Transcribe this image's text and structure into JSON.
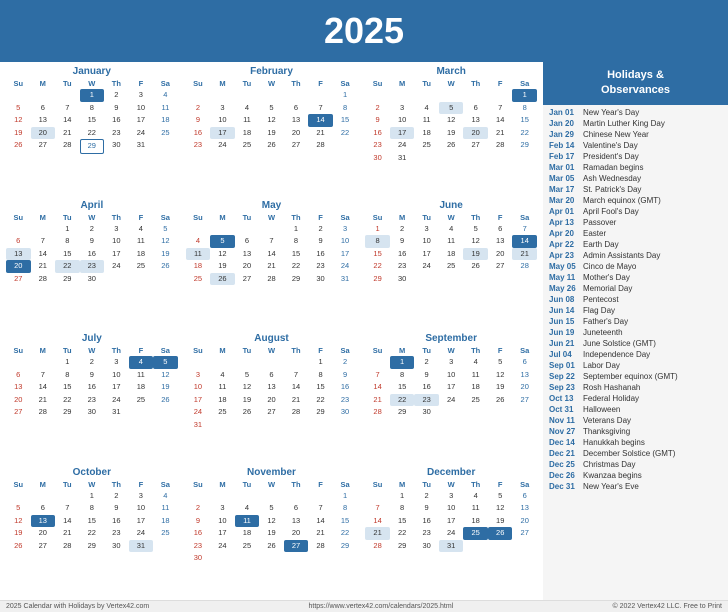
{
  "header": {
    "year": "2025"
  },
  "footer": {
    "left": "2025 Calendar with Holidays by Vertex42.com",
    "center": "https://www.vertex42.com/calendars/2025.html",
    "right": "© 2022 Vertex42 LLC. Free to Print"
  },
  "holidays_header": "Holidays &\nObservances",
  "holidays": [
    {
      "date": "Jan 01",
      "name": "New Year's Day"
    },
    {
      "date": "Jan 20",
      "name": "Martin Luther King Day"
    },
    {
      "date": "Jan 29",
      "name": "Chinese New Year"
    },
    {
      "date": "Feb 14",
      "name": "Valentine's Day"
    },
    {
      "date": "Feb 17",
      "name": "President's Day"
    },
    {
      "date": "Mar 01",
      "name": "Ramadan begins"
    },
    {
      "date": "Mar 05",
      "name": "Ash Wednesday"
    },
    {
      "date": "Mar 17",
      "name": "St. Patrick's Day"
    },
    {
      "date": "Mar 20",
      "name": "March equinox (GMT)"
    },
    {
      "date": "Apr 01",
      "name": "April Fool's Day"
    },
    {
      "date": "Apr 13",
      "name": "Passover"
    },
    {
      "date": "Apr 20",
      "name": "Easter"
    },
    {
      "date": "Apr 22",
      "name": "Earth Day"
    },
    {
      "date": "Apr 23",
      "name": "Admin Assistants Day"
    },
    {
      "date": "May 05",
      "name": "Cinco de Mayo"
    },
    {
      "date": "May 11",
      "name": "Mother's Day"
    },
    {
      "date": "May 26",
      "name": "Memorial Day"
    },
    {
      "date": "Jun 08",
      "name": "Pentecost"
    },
    {
      "date": "Jun 14",
      "name": "Flag Day"
    },
    {
      "date": "Jun 15",
      "name": "Father's Day"
    },
    {
      "date": "Jun 19",
      "name": "Juneteenth"
    },
    {
      "date": "Jun 21",
      "name": "June Solstice (GMT)"
    },
    {
      "date": "Jul 04",
      "name": "Independence Day"
    },
    {
      "date": "Sep 01",
      "name": "Labor Day"
    },
    {
      "date": "Sep 22",
      "name": "September equinox (GMT)"
    },
    {
      "date": "Sep 23",
      "name": "Rosh Hashanah"
    },
    {
      "date": "Oct 13",
      "name": "Federal Holiday"
    },
    {
      "date": "Oct 31",
      "name": "Halloween"
    },
    {
      "date": "Nov 11",
      "name": "Veterans Day"
    },
    {
      "date": "Nov 27",
      "name": "Thanksgiving"
    },
    {
      "date": "Dec 14",
      "name": "Hanukkah begins"
    },
    {
      "date": "Dec 21",
      "name": "December Solstice (GMT)"
    },
    {
      "date": "Dec 25",
      "name": "Christmas Day"
    },
    {
      "date": "Dec 26",
      "name": "Kwanzaa begins"
    },
    {
      "date": "Dec 31",
      "name": "New Year's Eve"
    }
  ],
  "months": [
    {
      "name": "January",
      "weeks": [
        [
          "",
          "",
          "",
          "1",
          "2",
          "3",
          "4"
        ],
        [
          "5",
          "6",
          "7",
          "8",
          "9",
          "10",
          "11"
        ],
        [
          "12",
          "13",
          "14",
          "15",
          "16",
          "17",
          "18"
        ],
        [
          "19",
          "20",
          "21",
          "22",
          "23",
          "24",
          "25"
        ],
        [
          "26",
          "27",
          "28",
          "29",
          "30",
          "31",
          ""
        ]
      ],
      "highlights": {
        "highlighted": [
          "1"
        ],
        "light": [
          "20"
        ],
        "outlined": [
          "29"
        ],
        "red": [
          "5",
          "12",
          "19",
          "26"
        ]
      }
    },
    {
      "name": "February",
      "weeks": [
        [
          "",
          "",
          "",
          "",
          "",
          "",
          "1"
        ],
        [
          "2",
          "3",
          "4",
          "5",
          "6",
          "7",
          "8"
        ],
        [
          "9",
          "10",
          "11",
          "12",
          "13",
          "14",
          "15"
        ],
        [
          "16",
          "17",
          "18",
          "19",
          "20",
          "21",
          "22"
        ],
        [
          "23",
          "24",
          "25",
          "26",
          "27",
          "28",
          ""
        ]
      ],
      "highlights": {
        "highlighted": [
          "14"
        ],
        "light": [
          "17"
        ],
        "outlined": [],
        "red": [
          "2",
          "9",
          "16",
          "23"
        ]
      }
    },
    {
      "name": "March",
      "weeks": [
        [
          "",
          "",
          "",
          "",
          "",
          "",
          "1"
        ],
        [
          "2",
          "3",
          "4",
          "5",
          "6",
          "7",
          "8"
        ],
        [
          "9",
          "10",
          "11",
          "12",
          "13",
          "14",
          "15"
        ],
        [
          "16",
          "17",
          "18",
          "19",
          "20",
          "21",
          "22"
        ],
        [
          "23",
          "24",
          "25",
          "26",
          "27",
          "28",
          "29"
        ],
        [
          "30",
          "31",
          "",
          "",
          "",
          "",
          ""
        ]
      ],
      "highlights": {
        "highlighted": [
          "1"
        ],
        "light": [
          "5",
          "17",
          "20"
        ],
        "outlined": [],
        "red": [
          "2",
          "9",
          "16",
          "23",
          "30"
        ]
      }
    },
    {
      "name": "April",
      "weeks": [
        [
          "",
          "",
          "1",
          "2",
          "3",
          "4",
          "5"
        ],
        [
          "6",
          "7",
          "8",
          "9",
          "10",
          "11",
          "12"
        ],
        [
          "13",
          "14",
          "15",
          "16",
          "17",
          "18",
          "19"
        ],
        [
          "20",
          "21",
          "22",
          "23",
          "24",
          "25",
          "26"
        ],
        [
          "27",
          "28",
          "29",
          "30",
          "",
          "",
          ""
        ]
      ],
      "highlights": {
        "highlighted": [
          "20"
        ],
        "light": [
          "13",
          "22",
          "23"
        ],
        "outlined": [],
        "red": [
          "6",
          "13",
          "20",
          "27"
        ]
      }
    },
    {
      "name": "May",
      "weeks": [
        [
          "",
          "",
          "",
          "",
          "1",
          "2",
          "3"
        ],
        [
          "4",
          "5",
          "6",
          "7",
          "8",
          "9",
          "10"
        ],
        [
          "11",
          "12",
          "13",
          "14",
          "15",
          "16",
          "17"
        ],
        [
          "18",
          "19",
          "20",
          "21",
          "22",
          "23",
          "24"
        ],
        [
          "25",
          "26",
          "27",
          "28",
          "29",
          "30",
          "31"
        ]
      ],
      "highlights": {
        "highlighted": [
          "5"
        ],
        "light": [
          "11",
          "26"
        ],
        "outlined": [
          "26"
        ],
        "red": [
          "4",
          "11",
          "18",
          "25"
        ]
      }
    },
    {
      "name": "June",
      "weeks": [
        [
          "1",
          "2",
          "3",
          "4",
          "5",
          "6",
          "7"
        ],
        [
          "8",
          "9",
          "10",
          "11",
          "12",
          "13",
          "14"
        ],
        [
          "15",
          "16",
          "17",
          "18",
          "19",
          "20",
          "21"
        ],
        [
          "22",
          "23",
          "24",
          "25",
          "26",
          "27",
          "28"
        ],
        [
          "29",
          "30",
          "",
          "",
          "",
          "",
          ""
        ]
      ],
      "highlights": {
        "highlighted": [
          "14"
        ],
        "light": [
          "8",
          "19",
          "21"
        ],
        "outlined": [],
        "red": [
          "1",
          "8",
          "15",
          "22",
          "29"
        ]
      }
    },
    {
      "name": "July",
      "weeks": [
        [
          "",
          "",
          "1",
          "2",
          "3",
          "4",
          "5"
        ],
        [
          "6",
          "7",
          "8",
          "9",
          "10",
          "11",
          "12"
        ],
        [
          "13",
          "14",
          "15",
          "16",
          "17",
          "18",
          "19"
        ],
        [
          "20",
          "21",
          "22",
          "23",
          "24",
          "25",
          "26"
        ],
        [
          "27",
          "28",
          "29",
          "30",
          "31",
          "",
          ""
        ]
      ],
      "highlights": {
        "highlighted": [
          "4",
          "5"
        ],
        "light": [],
        "outlined": [],
        "red": [
          "6",
          "13",
          "20",
          "27"
        ]
      }
    },
    {
      "name": "August",
      "weeks": [
        [
          "",
          "",
          "",
          "",
          "",
          "1",
          "2"
        ],
        [
          "3",
          "4",
          "5",
          "6",
          "7",
          "8",
          "9"
        ],
        [
          "10",
          "11",
          "12",
          "13",
          "14",
          "15",
          "16"
        ],
        [
          "17",
          "18",
          "19",
          "20",
          "21",
          "22",
          "23"
        ],
        [
          "24",
          "25",
          "26",
          "27",
          "28",
          "29",
          "30"
        ],
        [
          "31",
          "",
          "",
          "",
          "",
          "",
          ""
        ]
      ],
      "highlights": {
        "highlighted": [],
        "light": [],
        "outlined": [],
        "red": [
          "3",
          "10",
          "17",
          "24",
          "31"
        ]
      }
    },
    {
      "name": "September",
      "weeks": [
        [
          "",
          "1",
          "2",
          "3",
          "4",
          "5",
          "6"
        ],
        [
          "7",
          "8",
          "9",
          "10",
          "11",
          "12",
          "13"
        ],
        [
          "14",
          "15",
          "16",
          "17",
          "18",
          "19",
          "20"
        ],
        [
          "21",
          "22",
          "23",
          "24",
          "25",
          "26",
          "27"
        ],
        [
          "28",
          "29",
          "30",
          "",
          "",
          "",
          ""
        ]
      ],
      "highlights": {
        "highlighted": [
          "1"
        ],
        "light": [
          "22",
          "23"
        ],
        "outlined": [],
        "red": [
          "7",
          "14",
          "21",
          "28"
        ]
      }
    },
    {
      "name": "October",
      "weeks": [
        [
          "",
          "",
          "",
          "1",
          "2",
          "3",
          "4"
        ],
        [
          "5",
          "6",
          "7",
          "8",
          "9",
          "10",
          "11"
        ],
        [
          "12",
          "13",
          "14",
          "15",
          "16",
          "17",
          "18"
        ],
        [
          "19",
          "20",
          "21",
          "22",
          "23",
          "24",
          "25"
        ],
        [
          "26",
          "27",
          "28",
          "29",
          "30",
          "31",
          ""
        ]
      ],
      "highlights": {
        "highlighted": [
          "13"
        ],
        "light": [
          "31"
        ],
        "outlined": [],
        "red": [
          "5",
          "12",
          "19",
          "26"
        ]
      }
    },
    {
      "name": "November",
      "weeks": [
        [
          "",
          "",
          "",
          "",
          "",
          "",
          "1"
        ],
        [
          "2",
          "3",
          "4",
          "5",
          "6",
          "7",
          "8"
        ],
        [
          "9",
          "10",
          "11",
          "12",
          "13",
          "14",
          "15"
        ],
        [
          "16",
          "17",
          "18",
          "19",
          "20",
          "21",
          "22"
        ],
        [
          "23",
          "24",
          "25",
          "26",
          "27",
          "28",
          "29"
        ],
        [
          "30",
          "",
          "",
          "",
          "",
          "",
          ""
        ]
      ],
      "highlights": {
        "highlighted": [
          "11",
          "27"
        ],
        "light": [],
        "outlined": [],
        "red": [
          "2",
          "9",
          "16",
          "23",
          "30"
        ]
      }
    },
    {
      "name": "December",
      "weeks": [
        [
          "",
          "1",
          "2",
          "3",
          "4",
          "5",
          "6"
        ],
        [
          "7",
          "8",
          "9",
          "10",
          "11",
          "12",
          "13"
        ],
        [
          "14",
          "15",
          "16",
          "17",
          "18",
          "19",
          "20"
        ],
        [
          "21",
          "22",
          "23",
          "24",
          "25",
          "26",
          "27"
        ],
        [
          "28",
          "29",
          "30",
          "31",
          "",
          "",
          ""
        ]
      ],
      "highlights": {
        "highlighted": [
          "25",
          "26"
        ],
        "light": [
          "21",
          "31"
        ],
        "outlined": [],
        "red": [
          "7",
          "14",
          "21",
          "28"
        ]
      }
    }
  ]
}
